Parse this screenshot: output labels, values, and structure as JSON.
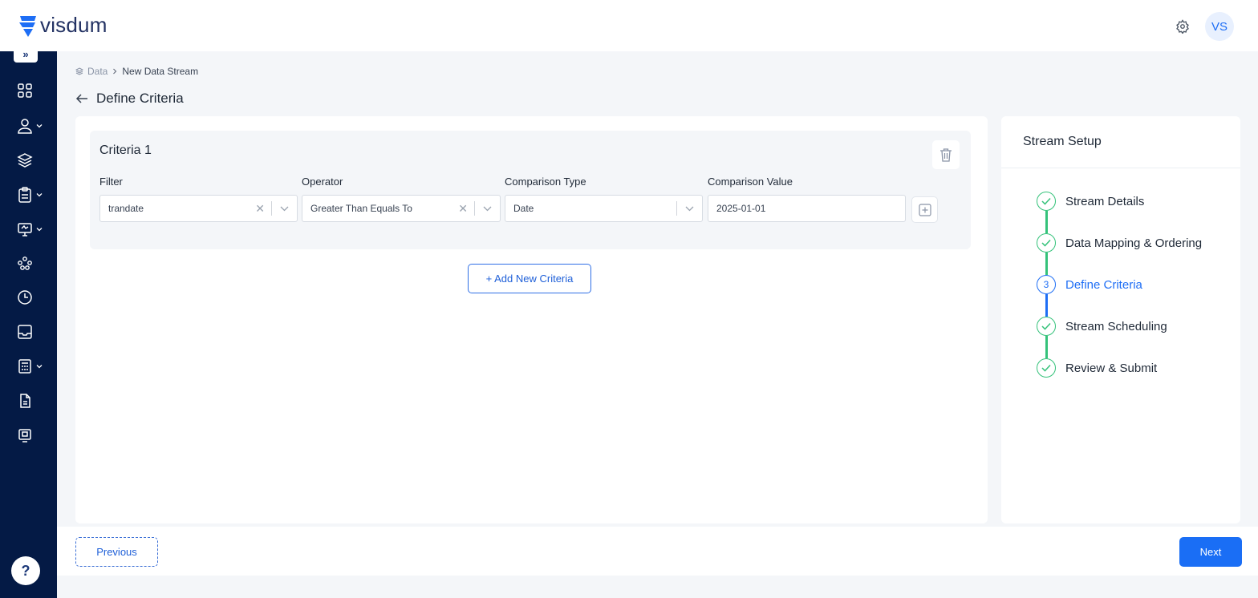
{
  "app": {
    "name": "visdum",
    "user_initials": "VS"
  },
  "colors": {
    "sidebar": "#041a45",
    "accent": "#1e6ef5",
    "success": "#34c27a"
  },
  "breadcrumb": {
    "root": "Data",
    "current": "New Data Stream"
  },
  "page": {
    "title": "Define Criteria"
  },
  "criteria": {
    "title": "Criteria 1",
    "filter_label": "Filter",
    "filter_value": "trandate",
    "operator_label": "Operator",
    "operator_value": "Greater Than Equals To",
    "comparison_type_label": "Comparison Type",
    "comparison_type_value": "Date",
    "comparison_value_label": "Comparison Value",
    "comparison_value": "2025-01-01"
  },
  "add_criteria_label": "+ Add New Criteria",
  "stream_setup": {
    "title": "Stream Setup",
    "steps": [
      {
        "label": "Stream Details",
        "status": "done"
      },
      {
        "label": "Data Mapping & Ordering",
        "status": "done"
      },
      {
        "label": "Define Criteria",
        "status": "current",
        "number": "3"
      },
      {
        "label": "Stream Scheduling",
        "status": "done"
      },
      {
        "label": "Review & Submit",
        "status": "done"
      }
    ]
  },
  "footer": {
    "previous_label": "Previous",
    "next_label": "Next"
  },
  "sidebar": {
    "expand_icon": "»",
    "help_label": "?",
    "items": [
      "dashboard-icon",
      "user-icon",
      "layers-icon",
      "clipboard-icon",
      "monitor-icon",
      "network-icon",
      "clock-icon",
      "inbox-icon",
      "calculator-icon",
      "document-icon",
      "report-icon"
    ]
  }
}
